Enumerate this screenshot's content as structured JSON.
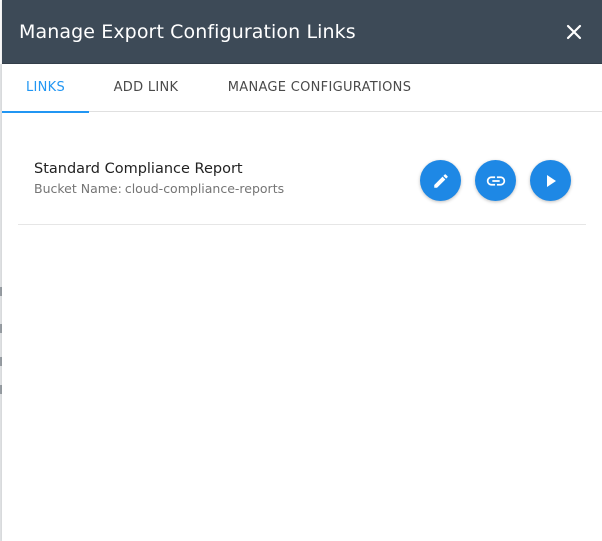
{
  "dialog": {
    "title": "Manage Export Configuration Links",
    "close_icon": "close-icon"
  },
  "tabs": [
    {
      "label": "LINKS",
      "active": true
    },
    {
      "label": "ADD LINK",
      "active": false
    },
    {
      "label": "MANAGE CONFIGURATIONS",
      "active": false
    }
  ],
  "links": [
    {
      "name": "Standard Compliance Report",
      "bucket_label": "Bucket Name:",
      "bucket_value": "cloud-compliance-reports",
      "actions": [
        {
          "icon": "pencil-icon",
          "action": "edit"
        },
        {
          "icon": "link-icon",
          "action": "copy-link"
        },
        {
          "icon": "play-icon",
          "action": "run"
        }
      ]
    }
  ],
  "colors": {
    "header_bg": "#3d4a57",
    "accent": "#2196f3",
    "fab": "#1e88e5",
    "text_primary": "#222222",
    "text_secondary": "#757575"
  }
}
